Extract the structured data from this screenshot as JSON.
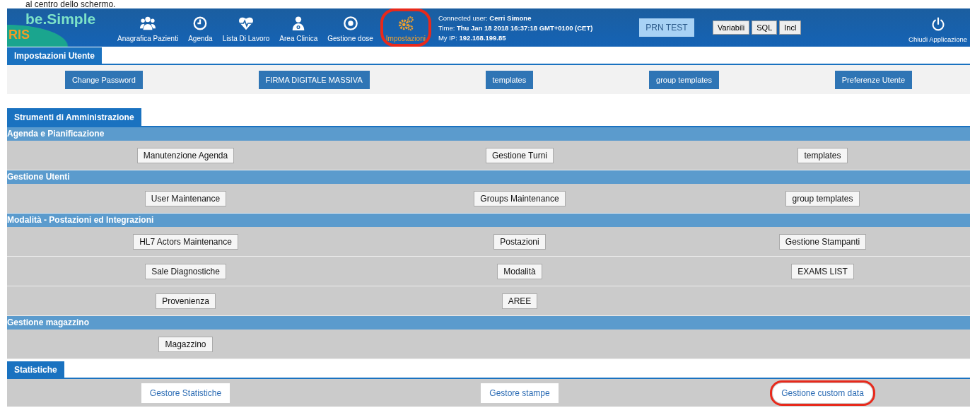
{
  "caption": "al centro dello schermo.",
  "logo": {
    "name": "be.Simple",
    "sub": "RIS"
  },
  "nav": [
    {
      "kind": "users",
      "label": "Anagrafica Pazienti",
      "selected": false,
      "annotated": false
    },
    {
      "kind": "clock",
      "label": "Agenda",
      "selected": false,
      "annotated": false
    },
    {
      "kind": "heart",
      "label": "Lista Di Lavoro",
      "selected": false,
      "annotated": false
    },
    {
      "kind": "doctor",
      "label": "Area Clinica",
      "selected": false,
      "annotated": false
    },
    {
      "kind": "target",
      "label": "Gestione dose",
      "selected": false,
      "annotated": false
    },
    {
      "kind": "gears",
      "label": "Impostazioni",
      "selected": true,
      "annotated": true
    }
  ],
  "session": [
    {
      "label": "Connected user:",
      "value": "Cerri Simone"
    },
    {
      "label": "Time:",
      "value": "Thu Jan 18 2018 16:37:18 GMT+0100 (CET)"
    },
    {
      "label": "My IP:",
      "value": "192.168.199.85"
    }
  ],
  "env_button": "PRN TEST",
  "tool_buttons": [
    "Variabili",
    "SQL",
    "Incl"
  ],
  "exit": {
    "label": "Chiudi Applicazione"
  },
  "user_settings": {
    "tab": "Impostazioni Utente",
    "buttons": [
      "Change Password",
      "FIRMA DIGITALE MASSIVA",
      "templates",
      "group templates",
      "Preferenze Utente"
    ]
  },
  "admin": {
    "tab": "Strumenti di Amministrazione",
    "sections": [
      {
        "title": "Agenda e Pianificazione",
        "rows": [
          [
            "Manutenzione Agenda",
            "Gestione Turni",
            "templates"
          ]
        ]
      },
      {
        "title": "Gestione Utenti",
        "rows": [
          [
            "User Maintenance",
            "Groups Maintenance",
            "group templates"
          ]
        ]
      },
      {
        "title": "Modalità - Postazioni ed Integrazioni",
        "rows": [
          [
            "HL7 Actors Maintenance",
            "Postazioni",
            "Gestione Stampanti"
          ],
          [
            "Sale Diagnostiche",
            "Modalità",
            "EXAMS LIST"
          ],
          [
            "Provenienza",
            "AREE"
          ]
        ]
      },
      {
        "title": "Gestione magazzino",
        "rows": [
          [
            "Magazzino"
          ]
        ]
      }
    ]
  },
  "stats": {
    "tab": "Statistiche",
    "links": [
      {
        "label": "Gestore Statistiche",
        "annotated": false
      },
      {
        "label": "Gestore stampe",
        "annotated": false
      },
      {
        "label": "Gestione custom data",
        "annotated": true
      }
    ]
  }
}
